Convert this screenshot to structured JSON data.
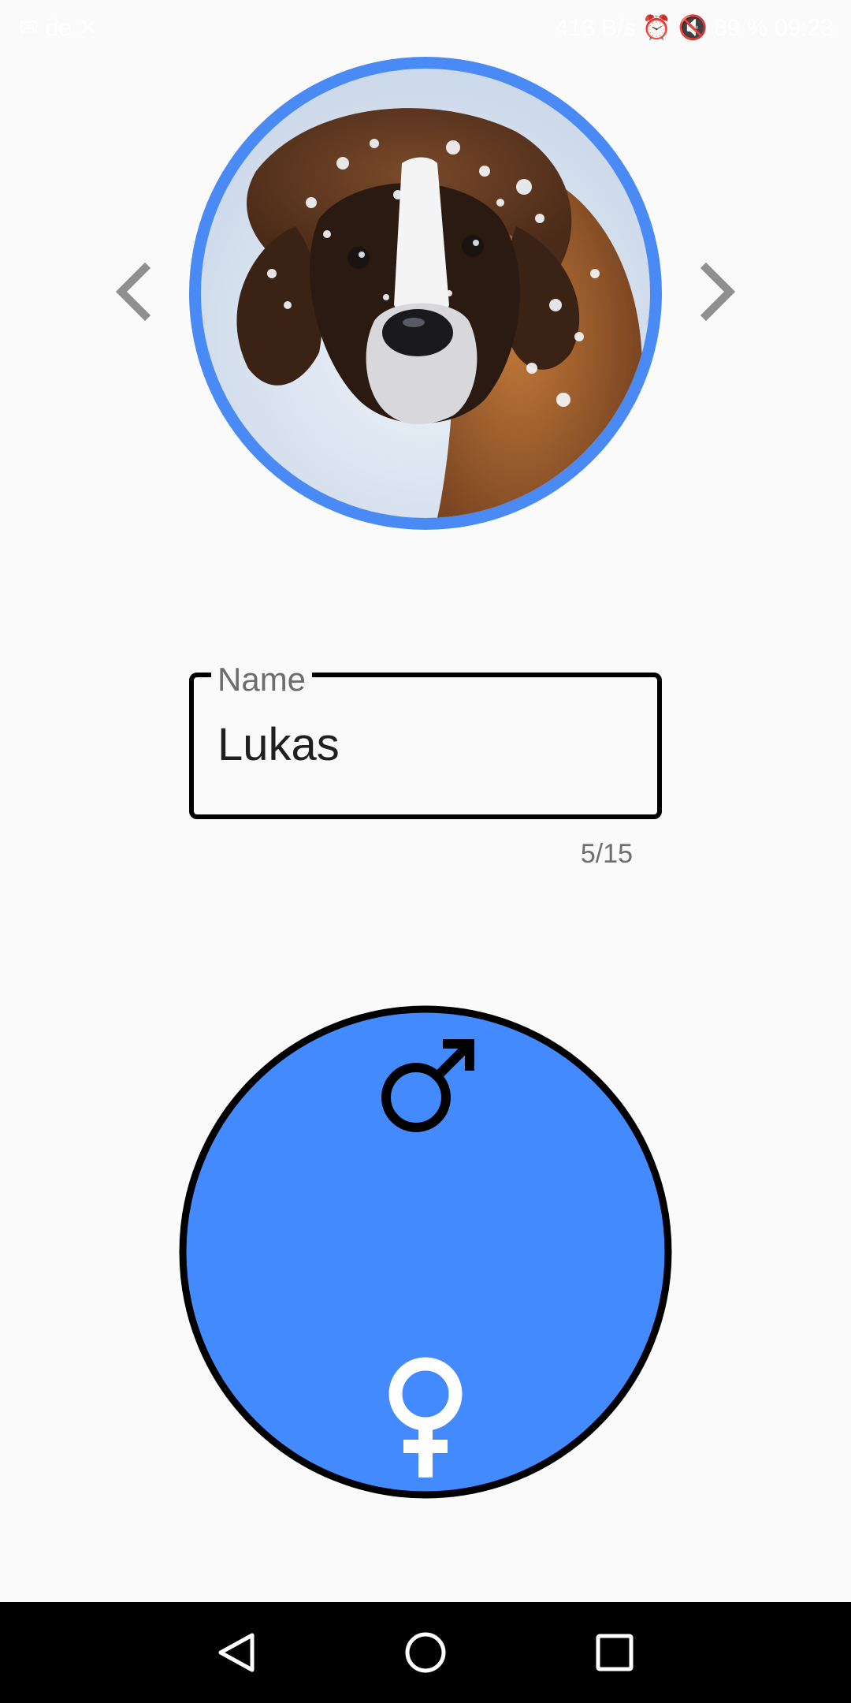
{
  "status_bar": {
    "left": "✉ de ✕",
    "right": "413 B/s ⏰ 🔇 89 % 09:23"
  },
  "profile": {
    "photo_icon": "dog-photo",
    "prev_icon": "chevron-left-icon",
    "next_icon": "chevron-right-icon"
  },
  "name_field": {
    "label": "Name",
    "value": "Lukas",
    "counter": "5/15"
  },
  "gender_selector": {
    "male_icon": "male-symbol-icon",
    "female_icon": "female-symbol-icon",
    "selected": "female"
  },
  "system_nav": {
    "back_icon": "triangle-back-icon",
    "home_icon": "circle-home-icon",
    "recents_icon": "square-recents-icon"
  },
  "colors": {
    "accent": "#4a8af4",
    "dial_fill": "#448aff",
    "background": "#fafafa",
    "arrow": "#8f8f8f"
  }
}
